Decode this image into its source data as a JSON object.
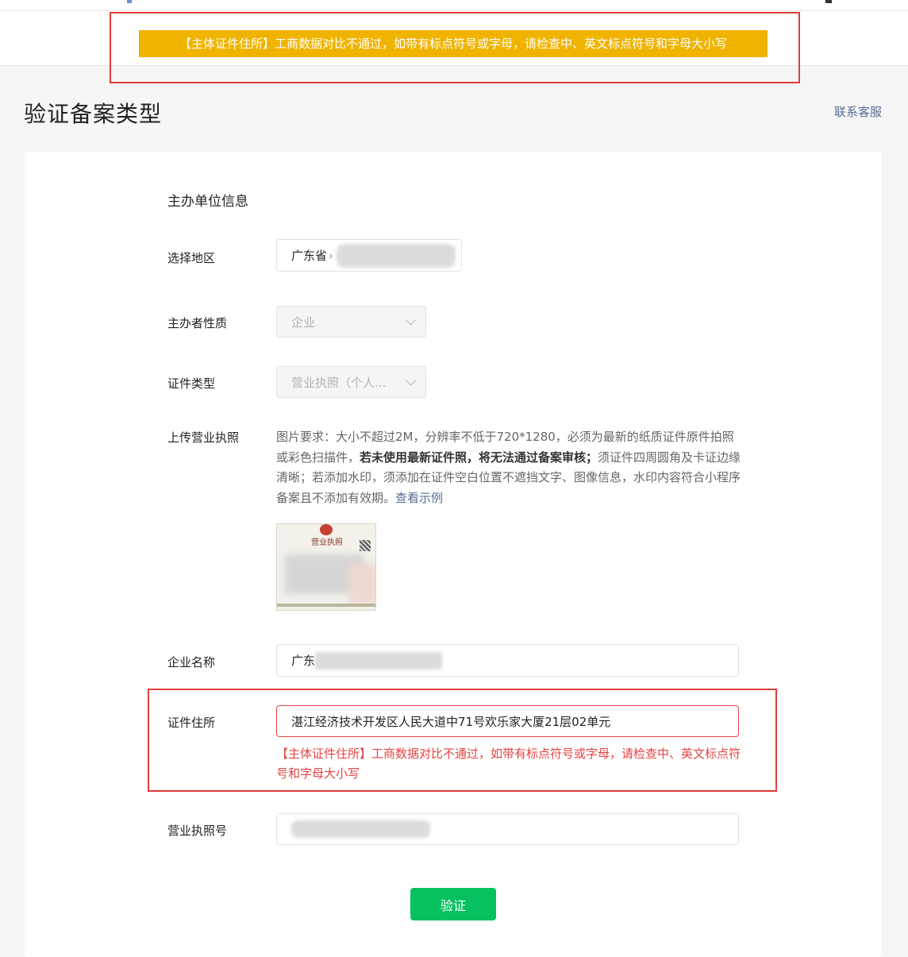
{
  "alert": {
    "message": "【主体证件住所】工商数据对比不通过，如带有标点符号或字母，请检查中、英文标点符号和字母大小写"
  },
  "header": {
    "title": "验证备案类型",
    "contact_link": "联系客服"
  },
  "form": {
    "section_title": "主办单位信息",
    "region": {
      "label": "选择地区",
      "value": "广东省"
    },
    "sponsor_type": {
      "label": "主办者性质",
      "value": "企业"
    },
    "cert_type": {
      "label": "证件类型",
      "value": "营业执照（个人..."
    },
    "upload": {
      "label": "上传营业执照",
      "desc_1": "图片要求：大小不超过2M，分辨率不低于720*1280，必须为最新的纸质证件原件拍照或彩色扫描件，",
      "desc_bold": "若未使用最新证件照，将无法通过备案审核；",
      "desc_2": "须证件四周圆角及卡证边缘清晰；若添加水印，须添加在证件空白位置不遮挡文字、图像信息，水印内容符合小程序备案且不添加有效期。",
      "example_link": "查看示例",
      "thumb_title": "营业执照"
    },
    "company_name": {
      "label": "企业名称",
      "value": "广东"
    },
    "cert_address": {
      "label": "证件住所",
      "value": "湛江经济技术开发区人民大道中71号欢乐家大厦21层02单元",
      "error": "【主体证件住所】工商数据对比不通过，如带有标点符号或字母，请检查中、英文标点符号和字母大小写"
    },
    "license_no": {
      "label": "营业执照号",
      "value": ""
    },
    "submit_label": "验证"
  },
  "colors": {
    "alert_bg": "#f0b400",
    "primary": "#07c160",
    "error": "#e64340",
    "link": "#576b95",
    "annotation": "#e23b3b"
  }
}
